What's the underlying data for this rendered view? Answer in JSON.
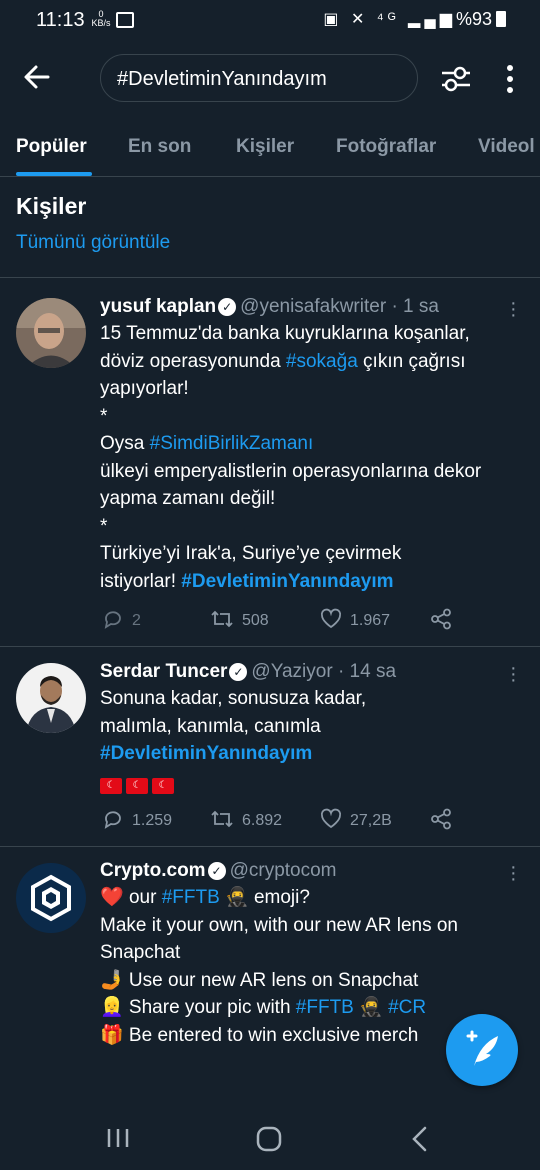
{
  "status_bar": {
    "time": "11:13",
    "kbs": "0\nKB/s",
    "battery": "%93"
  },
  "search": {
    "query": "#DevletiminYanındayım"
  },
  "tabs": [
    "Popüler",
    "En son",
    "Kişiler",
    "Fotoğraflar",
    "Videol"
  ],
  "people_section": {
    "title": "Kişiler",
    "view_all": "Tümünü görüntüle"
  },
  "tweets": [
    {
      "name": "yusuf kaplan",
      "handle": "@yenisafakwriter",
      "time": "· 1 sa",
      "body": [
        [
          {
            "t": "15 Temmuz'da banka kuyruklarına koşanlar,"
          }
        ],
        [
          {
            "t": "döviz operasyonunda "
          },
          {
            "t": "#sokağa",
            "c": "tag"
          },
          {
            "t": " çıkın çağrısı"
          }
        ],
        [
          {
            "t": "yapıyorlar!"
          }
        ],
        [
          {
            "t": "*"
          }
        ],
        [
          {
            "t": "Oysa "
          },
          {
            "t": "#SimdiBirlikZamanı",
            "c": "tag"
          }
        ],
        [
          {
            "t": "ülkeyi emperyalistlerin operasyonlarına dekor"
          }
        ],
        [
          {
            "t": "yapma zamanı değil!"
          }
        ],
        [
          {
            "t": "*"
          }
        ],
        [
          {
            "t": "Türkiye’yi Irak'a, Suriye’ye çevirmek"
          }
        ],
        [
          {
            "t": "istiyorlar! "
          },
          {
            "t": "#DevletiminYanındayım",
            "c": "tag bold"
          }
        ]
      ],
      "replies": "2",
      "retweets": "508",
      "likes": "1.967"
    },
    {
      "name": "Serdar Tuncer",
      "handle": "@Yaziyor",
      "time": "· 14 sa",
      "body": [
        [
          {
            "t": "Sonuna kadar, sonusuza kadar,"
          }
        ],
        [
          {
            "t": "malımla, kanımla, canımla"
          }
        ],
        [
          {
            "t": "#DevletiminYanındayım",
            "c": "tag bold"
          }
        ]
      ],
      "flags": 3,
      "replies": "1.259",
      "retweets": "6.892",
      "likes": "27,2B"
    },
    {
      "name": "Crypto.com",
      "handle": "@cryptocom",
      "time": "",
      "body": [
        [
          {
            "t": "❤️ ",
            "c": "heart"
          },
          {
            "t": "our "
          },
          {
            "t": "#FFTB",
            "c": "tag"
          },
          {
            "t": " 🥷 emoji?"
          }
        ],
        [
          {
            "t": "Make it your own, with our new AR lens on"
          }
        ],
        [
          {
            "t": "Snapchat"
          }
        ],
        [
          {
            "t": " "
          }
        ],
        [
          {
            "t": "🤳 Use our new AR lens on Snapchat"
          }
        ],
        [
          {
            "t": "👱‍♀️ Share your pic with "
          },
          {
            "t": "#FFTB",
            "c": "tag"
          },
          {
            "t": " 🥷 "
          },
          {
            "t": "#CR",
            "c": "tag"
          }
        ],
        [
          {
            "t": "🎁 Be entered to win exclusive merch"
          }
        ]
      ]
    }
  ],
  "colors": {
    "background": "#15202b",
    "accent": "#1d9bf0",
    "divider": "#38444d",
    "muted": "#8b98a5"
  }
}
